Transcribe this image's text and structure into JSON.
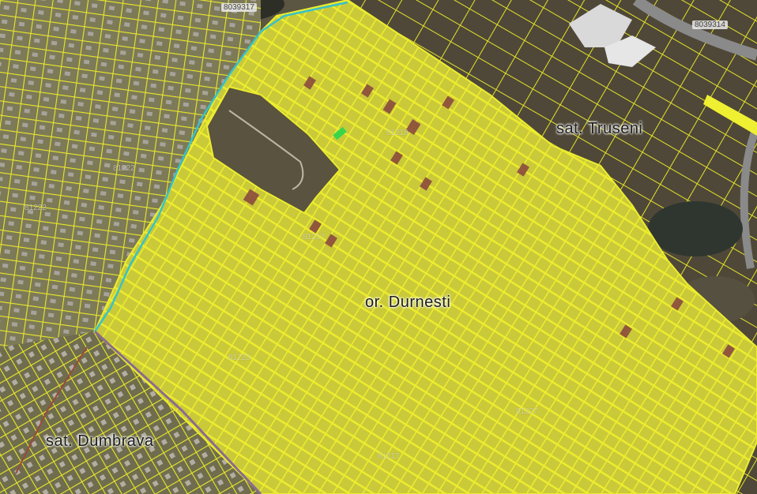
{
  "map": {
    "colors": {
      "parcel_outline": "#e9e92c",
      "parcel_fill": "#c8c838",
      "parcel_highlight": "#8b4a3e",
      "selected_parcel": "#39d64a",
      "road_line": "#36c2c8",
      "boundary_line": "#8a6a8f",
      "terrain": "#5b5642"
    },
    "labels": {
      "village_truseni": "sat. Truseni",
      "village_dumbrava": "sat. Dumbrava",
      "locality_dumesti": "or. Durnesti"
    },
    "parcel_ids": {
      "top_center": "8039317",
      "top_right": "8039314",
      "center_upper": "81219",
      "center_mid": "81217",
      "left_mid": "81222",
      "left_lower": "81222",
      "lower_mid": "81223",
      "bottom_center": "81217",
      "right_lower": "81227"
    }
  }
}
